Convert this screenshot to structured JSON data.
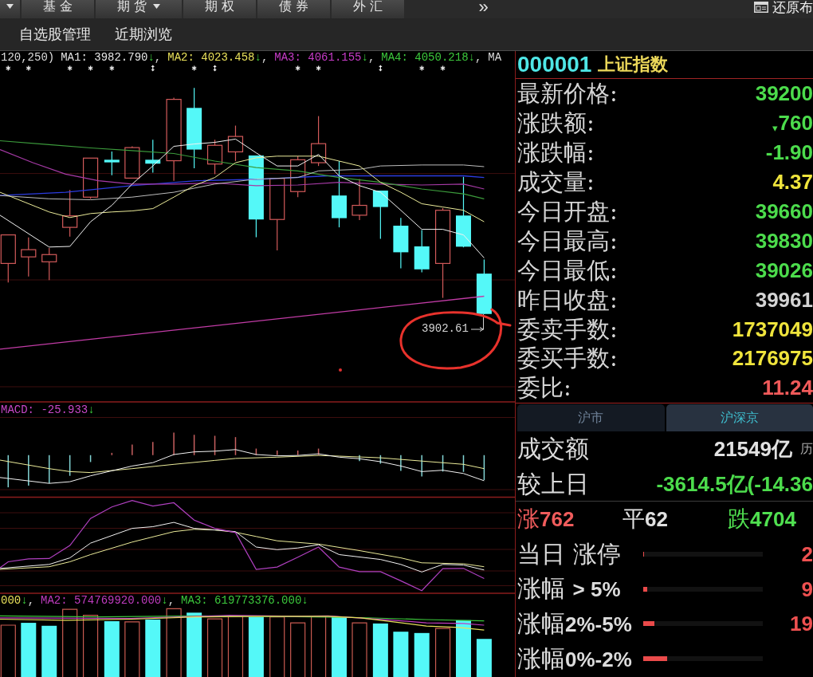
{
  "top_bar": {
    "leading_dropdown": true,
    "tabs": [
      {
        "label": "基 金",
        "dropdown": false,
        "selected": false
      },
      {
        "label": "期 货",
        "dropdown": true,
        "selected": false
      },
      {
        "label": "期 权",
        "dropdown": false,
        "selected": false
      },
      {
        "label": "债 券",
        "dropdown": false,
        "selected": false
      },
      {
        "label": "外 汇",
        "dropdown": false,
        "selected": false
      }
    ],
    "more": "»",
    "restore": "还原布"
  },
  "sub_bar": {
    "items": [
      "自选股管理",
      "近期浏览"
    ]
  },
  "kline": {
    "legend": [
      {
        "text": "120,250)",
        "color": "#dcdcdc"
      },
      {
        "text": "MA1: 3982.790",
        "color": "#e6e6e6",
        "arrow": "↓",
        "separator": ","
      },
      {
        "text": "MA2: 4023.458",
        "color": "#e8e05a",
        "arrow": "↓",
        "separator": ","
      },
      {
        "text": "MA3: 4061.155",
        "color": "#c83cc8",
        "arrow": "↓",
        "separator": ","
      },
      {
        "text": "MA4: 4050.218",
        "color": "#3cc83c",
        "arrow": "↓",
        "separator": ","
      },
      {
        "text": "MA",
        "color": "#dcdcdc"
      }
    ],
    "low_label": "3902.61"
  },
  "macd": {
    "legend": [
      {
        "text": "MACD: -25.933",
        "color": "#c848c8",
        "arrow": "↓"
      }
    ]
  },
  "volume": {
    "legend": [
      {
        "text": "000",
        "color": "#e8e05a",
        "arrow": "↓",
        "separator": ","
      },
      {
        "text": "MA2: 574769920.000",
        "color": "#c03cc0",
        "arrow": "↓",
        "separator": ","
      },
      {
        "text": "MA3: 619773376.000",
        "color": "#3cc83c",
        "arrow": "↓"
      }
    ]
  },
  "quote": {
    "code": "000001",
    "name": "上证指数",
    "rows": [
      {
        "label": "最新价格:",
        "value": "39200",
        "color": "#4cdc4c"
      },
      {
        "label": "涨跌额:",
        "value": "760",
        "color": "#4cdc4c",
        "arrow": "▾"
      },
      {
        "label": "涨跌幅:",
        "value": "-1.90",
        "color": "#4cdc4c"
      },
      {
        "label": "成交量:",
        "value": "4.37",
        "color": "#efe43c"
      },
      {
        "label": "今日开盘:",
        "value": "39660",
        "color": "#4cdc4c"
      },
      {
        "label": "今日最高:",
        "value": "39830",
        "color": "#4cdc4c"
      },
      {
        "label": "今日最低:",
        "value": "39026",
        "color": "#4cdc4c"
      },
      {
        "label": "昨日收盘:",
        "value": "39961",
        "color": "#d4d4d4"
      },
      {
        "label": "委卖手数:",
        "value": "1737049",
        "color": "#efe43c"
      },
      {
        "label": "委买手数:",
        "value": "2176975",
        "color": "#efe43c"
      },
      {
        "label": "委比:",
        "value": "11.24",
        "color": "#f05a5a"
      }
    ]
  },
  "market": {
    "tabs": [
      {
        "label": "沪市",
        "selected": false
      },
      {
        "label": "沪深京",
        "selected": true
      }
    ],
    "turnover": {
      "label": "成交额",
      "value": "21549亿",
      "note": "历"
    },
    "change": {
      "label": "较上日",
      "value": "-3614.5亿(-14.36"
    },
    "breadth": [
      {
        "text": "涨**762**",
        "color": "#f05c5c"
      },
      {
        "text": "平**62**",
        "color": "#e0e0e0"
      },
      {
        "text": "跌**4704**",
        "color": "#50e050"
      }
    ],
    "distribution": [
      {
        "label": "当日 涨停",
        "level": 0.007,
        "value": "2"
      },
      {
        "label": "涨幅 **> 5%**",
        "level": 0.03,
        "value": "9"
      },
      {
        "label": "涨幅**2%-5%**",
        "level": 0.09,
        "value": "19"
      },
      {
        "label": "涨幅**0%-2%**",
        "level": 0.2
      }
    ]
  }
}
